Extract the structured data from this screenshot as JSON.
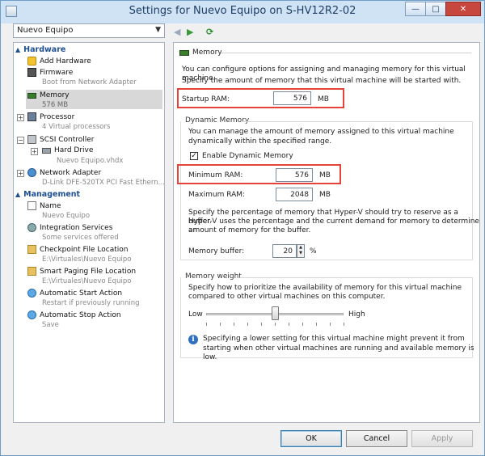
{
  "window": {
    "title": "Settings for Nuevo Equipo on S-HV12R2-02"
  },
  "vm_selector": {
    "value": "Nuevo Equipo"
  },
  "tree": {
    "hardware_label": "Hardware",
    "management_label": "Management",
    "hardware": [
      {
        "label": "Add Hardware",
        "sub": ""
      },
      {
        "label": "Firmware",
        "sub": "Boot from Network Adapter"
      },
      {
        "label": "Memory",
        "sub": "576 MB"
      },
      {
        "label": "Processor",
        "sub": "4 Virtual processors"
      },
      {
        "label": "SCSI Controller",
        "sub": ""
      },
      {
        "label": "Hard Drive",
        "sub": "Nuevo Equipo.vhdx"
      },
      {
        "label": "Network Adapter",
        "sub": "D-Link DFE-520TX PCI Fast Ethern..."
      }
    ],
    "management": [
      {
        "label": "Name",
        "sub": "Nuevo Equipo"
      },
      {
        "label": "Integration Services",
        "sub": "Some services offered"
      },
      {
        "label": "Checkpoint File Location",
        "sub": "E:\\Virtuales\\Nuevo Equipo"
      },
      {
        "label": "Smart Paging File Location",
        "sub": "E:\\Virtuales\\Nuevo Equipo"
      },
      {
        "label": "Automatic Start Action",
        "sub": "Restart if previously running"
      },
      {
        "label": "Automatic Stop Action",
        "sub": "Save"
      }
    ]
  },
  "memory": {
    "header": "Memory",
    "intro": "You can configure options for assigning and managing memory for this virtual machine.",
    "startup_desc": "Specify the amount of memory that this virtual machine will be started with.",
    "startup_label": "Startup RAM:",
    "startup_value": "576",
    "unit_mb": "MB",
    "dynamic": {
      "title": "Dynamic Memory",
      "desc1": "You can manage the amount of memory assigned to this virtual machine",
      "desc2": "dynamically within the specified range.",
      "enable_label": "Enable Dynamic Memory",
      "enable_checked": "✓",
      "min_label": "Minimum RAM:",
      "min_value": "576",
      "max_label": "Maximum RAM:",
      "max_value": "2048",
      "buffer_desc1": "Specify the percentage of memory that Hyper-V should try to reserve as a buffer.",
      "buffer_desc2": "Hyper-V uses the percentage and the current demand for memory to determine an",
      "buffer_desc3": "amount of memory for the buffer.",
      "buffer_label": "Memory buffer:",
      "buffer_value": "20",
      "percent": "%"
    },
    "weight": {
      "title": "Memory weight",
      "desc1": "Specify how to prioritize the availability of memory for this virtual machine",
      "desc2": "compared to other virtual machines on this computer.",
      "low_label": "Low",
      "high_label": "High",
      "level": 0.5,
      "info1": "Specifying a lower setting for this virtual machine might prevent it from",
      "info2": "starting when other virtual machines are running and available memory is low."
    }
  },
  "buttons": {
    "ok": "OK",
    "cancel": "Cancel",
    "apply": "Apply"
  },
  "colors": {
    "highlight": "#e5423a",
    "category": "#1e4f92"
  }
}
